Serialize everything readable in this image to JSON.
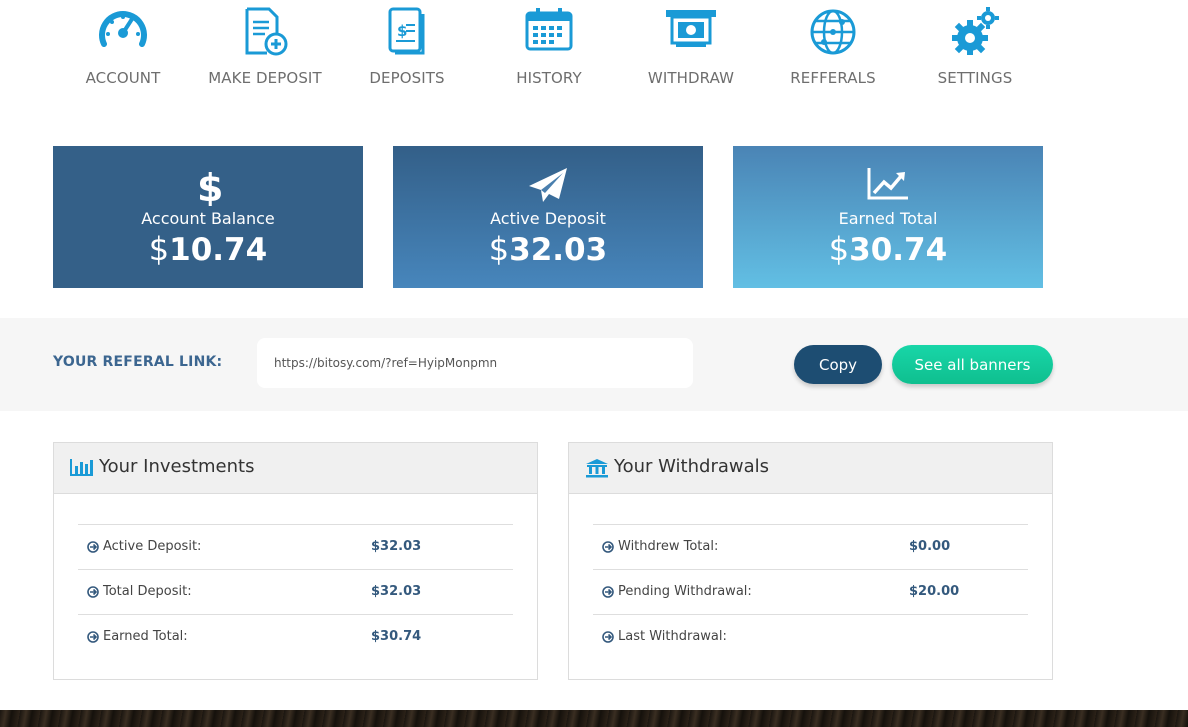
{
  "nav": {
    "items": [
      {
        "label": "ACCOUNT",
        "icon": "speedometer-icon"
      },
      {
        "label": "MAKE DEPOSIT",
        "icon": "document-add-icon"
      },
      {
        "label": "DEPOSITS",
        "icon": "dollar-document-icon"
      },
      {
        "label": "HISTORY",
        "icon": "calendar-icon"
      },
      {
        "label": "WITHDRAW",
        "icon": "cash-dispenser-icon"
      },
      {
        "label": "REFFERALS",
        "icon": "globe-icon"
      },
      {
        "label": "SETTINGS",
        "icon": "gears-icon"
      }
    ],
    "icon_color": "#1a9ad6"
  },
  "cards": [
    {
      "title": "Account Balance",
      "currency": "$",
      "amount": "10.74",
      "icon": "dollar-icon"
    },
    {
      "title": "Active Deposit",
      "currency": "$",
      "amount": "32.03",
      "icon": "paper-plane-icon"
    },
    {
      "title": "Earned Total",
      "currency": "$",
      "amount": "30.74",
      "icon": "trend-chart-icon"
    }
  ],
  "referral": {
    "label": "YOUR REFERAL LINK:",
    "link": "https://bitosy.com/?ref=HyipMonpmn",
    "copy_label": "Copy",
    "banners_label": "See all banners"
  },
  "investments": {
    "title": "Your Investments",
    "icon": "bar-chart-icon",
    "rows": [
      {
        "label": "Active Deposit:",
        "value": "$32.03"
      },
      {
        "label": "Total Deposit:",
        "value": "$32.03"
      },
      {
        "label": "Earned Total:",
        "value": "$30.74"
      }
    ]
  },
  "withdrawals": {
    "title": "Your Withdrawals",
    "icon": "bank-icon",
    "rows": [
      {
        "label": "Withdrew Total:",
        "value": "$0.00"
      },
      {
        "label": "Pending Withdrawal:",
        "value": "$20.00"
      },
      {
        "label": "Last Withdrawal:",
        "value": ""
      }
    ]
  },
  "colors": {
    "accent": "#1a9ad6",
    "dark_blue": "#1d4d72",
    "green": "#13cc9c",
    "value_text": "#34597d"
  }
}
